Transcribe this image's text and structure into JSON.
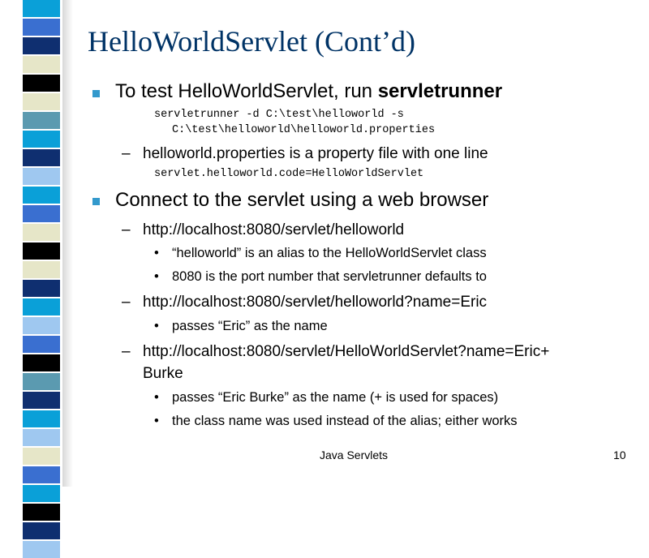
{
  "slide": {
    "title": "HelloWorldServlet (Cont’d)",
    "bullet1": {
      "prefix": "To test HelloWorldServlet, run ",
      "emphasis": "servletrunner",
      "code_line1": "servletrunner -d C:\\test\\helloworld -s",
      "code_line2": "C:\\test\\helloworld\\helloworld.properties",
      "sub1": "helloworld.properties is a property file with one line",
      "sub1_code": "servlet.helloworld.code=HelloWorldServlet"
    },
    "bullet2": {
      "text": "Connect to the servlet using a web browser",
      "sub1": "http://localhost:8080/servlet/helloworld",
      "sub1_points": [
        "“helloworld” is an alias to the HelloWorldServlet class",
        "8080 is the port number that servletrunner defaults to"
      ],
      "sub2": "http://localhost:8080/servlet/helloworld?name=Eric",
      "sub2_points": [
        "passes “Eric” as the name"
      ],
      "sub3_line1": "http://localhost:8080/servlet/HelloWorldServlet?name=Eric+",
      "sub3_line2": "Burke",
      "sub3_points": [
        "passes “Eric Burke” as the name (+ is used for spaces)",
        "the class name was used instead of the alias; either works"
      ]
    },
    "dash_glyph": "–",
    "dot_glyph": "•"
  },
  "footer": {
    "center": "Java Servlets",
    "page_number": "10"
  },
  "colors": {
    "title": "#003366",
    "bullet": "#3399cc",
    "sidebar_palette": [
      "#0f2f70",
      "#3a6fd0",
      "#9fc8f0",
      "#e6e6c8",
      "#000000",
      "#5b9ab0",
      "#0aa0d8"
    ]
  }
}
